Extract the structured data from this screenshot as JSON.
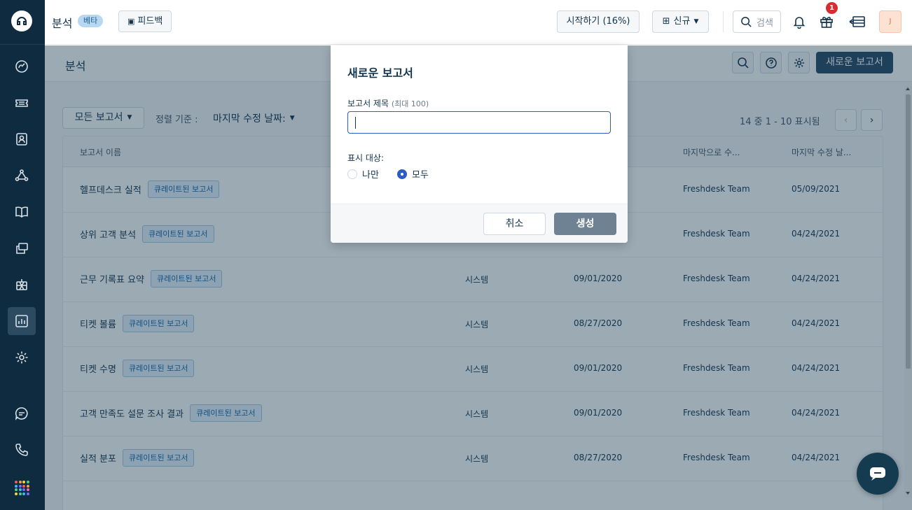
{
  "topbar": {
    "title": "분석",
    "beta": "베타",
    "feedback": "피드백",
    "start": "시작하기 (16%)",
    "new": "신규",
    "search_placeholder": "검색",
    "notification_count": "1",
    "avatar_initial": "J"
  },
  "sidebar": {
    "items": [
      {
        "icon": "dashboard-icon"
      },
      {
        "icon": "ticket-icon"
      },
      {
        "icon": "contacts-icon"
      },
      {
        "icon": "social-icon"
      },
      {
        "icon": "solutions-book-icon"
      },
      {
        "icon": "forums-icon"
      },
      {
        "icon": "bot-icon"
      },
      {
        "icon": "analytics-icon",
        "active": true
      },
      {
        "icon": "admin-gear-icon"
      },
      {
        "icon": "chat-icon"
      },
      {
        "icon": "phone-icon"
      }
    ]
  },
  "page": {
    "title": "분석",
    "new_report": "새로운 보고서",
    "filter": "모든 보고서",
    "sort_label": "정렬 기준 :",
    "sort_value": "마지막 수정 날짜:",
    "pager": "14 중 1 - 10 표시됨"
  },
  "table": {
    "headers": [
      "보고서 이름",
      "마지막으로 수...",
      "마지막 수정 날..."
    ],
    "tag": "큐레이트된 보고서",
    "rows": [
      {
        "name": "헬프데스크 실적",
        "creator": "",
        "created": "",
        "modifier": "Freshdesk Team",
        "modified": "05/09/2021"
      },
      {
        "name": "상위 고객 분석",
        "creator": "",
        "created": "",
        "modifier": "Freshdesk Team",
        "modified": "04/24/2021"
      },
      {
        "name": "근무 기록표 요약",
        "creator": "시스템",
        "created": "09/01/2020",
        "modifier": "Freshdesk Team",
        "modified": "04/24/2021"
      },
      {
        "name": "티켓 볼륨",
        "creator": "시스템",
        "created": "08/27/2020",
        "modifier": "Freshdesk Team",
        "modified": "04/24/2021"
      },
      {
        "name": "티켓 수명",
        "creator": "시스템",
        "created": "09/01/2020",
        "modifier": "Freshdesk Team",
        "modified": "04/24/2021"
      },
      {
        "name": "고객 만족도 설문 조사 결과",
        "creator": "시스템",
        "created": "09/01/2020",
        "modifier": "Freshdesk Team",
        "modified": "04/24/2021"
      },
      {
        "name": "실적 분포",
        "creator": "시스템",
        "created": "08/27/2020",
        "modifier": "Freshdesk Team",
        "modified": "04/24/2021"
      }
    ]
  },
  "modal": {
    "title": "새로운 보고서",
    "field_label": "보고서 제목",
    "field_hint": "(최대 100)",
    "field_value": "",
    "show_label": "표시 대상:",
    "option_me": "나만",
    "option_all": "모두",
    "selected": "모두",
    "cancel": "취소",
    "create": "생성"
  },
  "colors": {
    "sidebar": "#0f2b40",
    "primary": "#264966",
    "accent_blue": "#2c5cc5",
    "badge_red": "#d72d30"
  }
}
